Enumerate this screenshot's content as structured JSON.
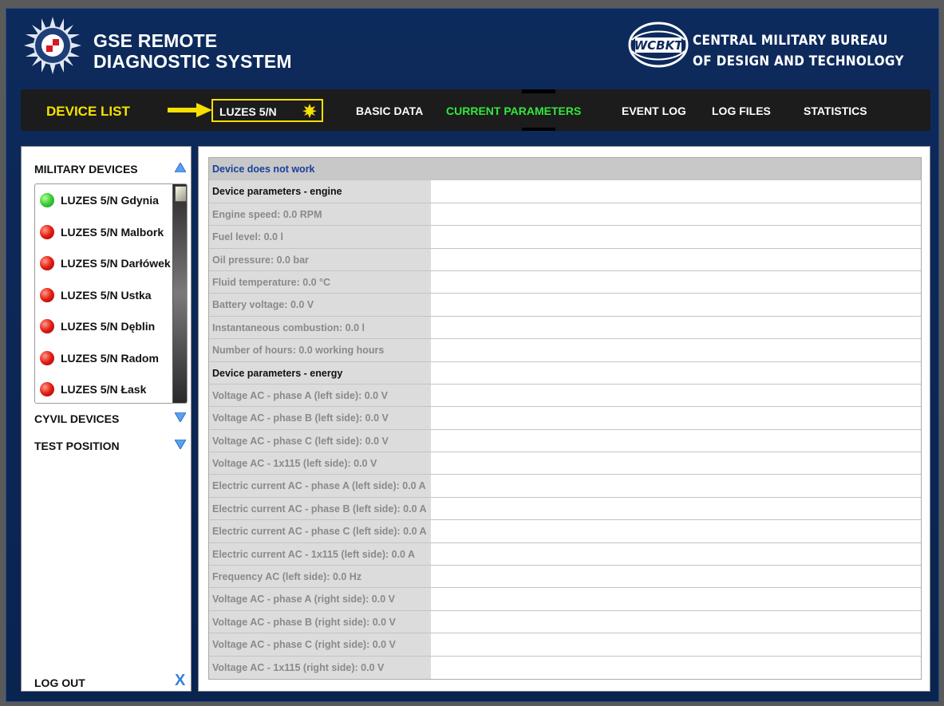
{
  "header": {
    "app_title_line1": "GSE REMOTE",
    "app_title_line2": "DIAGNOSTIC SYSTEM",
    "org_title_line1": "CENTRAL MILITARY BUREAU",
    "org_title_line2": "OF DESIGN AND TECHNOLOGY",
    "logo_left": "institute-emblem",
    "logo_right_text": "WCBKT"
  },
  "nav": {
    "device_list_label": "DEVICE LIST",
    "selected_device": "LUZES 5/N",
    "tabs": [
      {
        "label": "BASIC DATA",
        "active": false
      },
      {
        "label": "CURRENT PARAMETERS",
        "active": true
      },
      {
        "label": "EVENT LOG",
        "active": false
      },
      {
        "label": "LOG FILES",
        "active": false
      },
      {
        "label": "STATISTICS",
        "active": false
      }
    ],
    "accent_color": "#f6e000",
    "active_color": "#32e83a"
  },
  "sidebar": {
    "groups": [
      {
        "label": "MILITARY DEVICES",
        "expanded": true
      },
      {
        "label": "CYVIL DEVICES",
        "expanded": false
      },
      {
        "label": "TEST POSITION",
        "expanded": false
      }
    ],
    "devices": [
      {
        "name": "LUZES 5/N Gdynia",
        "status": "green"
      },
      {
        "name": "LUZES 5/N Malbork",
        "status": "red"
      },
      {
        "name": "LUZES 5/N Darłówek",
        "status": "red"
      },
      {
        "name": "LUZES 5/N Ustka",
        "status": "red"
      },
      {
        "name": "LUZES 5/N Dęblin",
        "status": "red"
      },
      {
        "name": "LUZES 5/N Radom",
        "status": "red"
      },
      {
        "name": "LUZES 5/N Łask",
        "status": "red"
      }
    ],
    "logout_label": "LOG OUT",
    "logout_icon": "X"
  },
  "parameters": {
    "status_text": "Device does not work",
    "rows": [
      {
        "text": "Device parameters - engine",
        "type": "section"
      },
      {
        "text": "Engine speed: 0.0 RPM",
        "type": "value"
      },
      {
        "text": "Fuel level: 0.0 l",
        "type": "value"
      },
      {
        "text": "Oil pressure: 0.0 bar",
        "type": "value"
      },
      {
        "text": "Fluid temperature: 0.0 °C",
        "type": "value"
      },
      {
        "text": "Battery voltage: 0.0 V",
        "type": "value"
      },
      {
        "text": "Instantaneous combustion: 0.0 l",
        "type": "value"
      },
      {
        "text": "Number of hours: 0.0 working hours",
        "type": "value"
      },
      {
        "text": "Device parameters - energy",
        "type": "section"
      },
      {
        "text": "Voltage AC - phase A (left side): 0.0 V",
        "type": "value"
      },
      {
        "text": "Voltage AC - phase B (left side): 0.0 V",
        "type": "value"
      },
      {
        "text": "Voltage AC - phase C (left side): 0.0 V",
        "type": "value"
      },
      {
        "text": "Voltage AC - 1x115  (left side): 0.0 V",
        "type": "value"
      },
      {
        "text": "Electric current AC - phase A (left side): 0.0 A",
        "type": "value"
      },
      {
        "text": "Electric current AC - phase B (left side): 0.0 A",
        "type": "value"
      },
      {
        "text": "Electric current AC - phase C (left side): 0.0 A",
        "type": "value"
      },
      {
        "text": "Electric current AC - 1x115  (left side): 0.0 A",
        "type": "value"
      },
      {
        "text": "Frequency AC (left side): 0.0 Hz",
        "type": "value"
      },
      {
        "text": "Voltage AC - phase A (right side): 0.0 V",
        "type": "value"
      },
      {
        "text": "Voltage AC - phase B (right side): 0.0 V",
        "type": "value"
      },
      {
        "text": "Voltage AC - phase C (right side): 0.0 V",
        "type": "value"
      },
      {
        "text": "Voltage AC - 1x115 (right side): 0.0 V",
        "type": "value"
      }
    ]
  }
}
